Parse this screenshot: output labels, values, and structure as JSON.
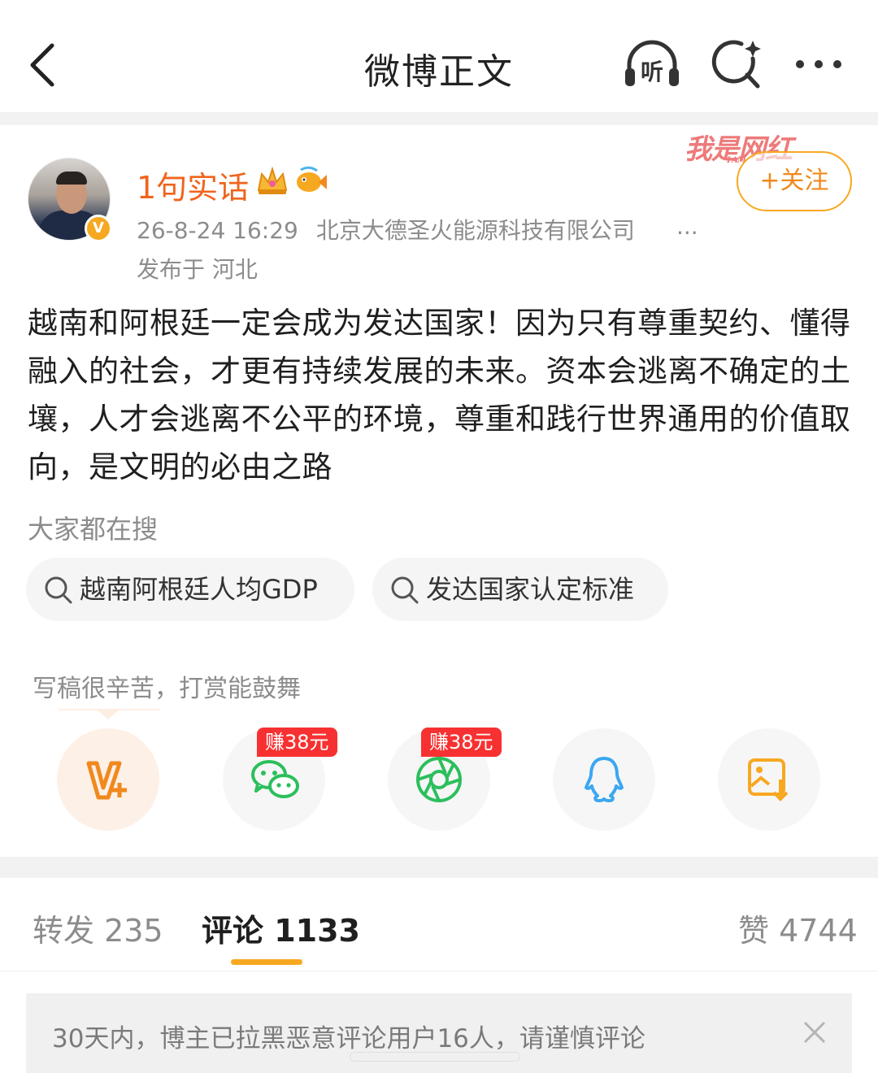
{
  "header": {
    "title": "微博正文"
  },
  "post": {
    "username": "1句实话",
    "date": "26-8-24 16:29",
    "source": "北京大德圣火能源科技有限公司",
    "meta_more": "...",
    "location": "发布于 河北",
    "verified_mark": "V",
    "follow_label": "+关注",
    "watermark_text": "我是网红",
    "watermark_sub": "I AM",
    "text": "越南和阿根廷一定会成为发达国家！因为只有尊重契约、懂得融入的社会，才更有持续发展的未来。资本会逃离不确定的土壤，人才会逃离不公平的环境，尊重和践行世界通用的价值取向，是文明的必由之路"
  },
  "hot_search": {
    "label": "大家都在搜",
    "items": [
      {
        "label": "越南阿根廷人均GDP"
      },
      {
        "label": "发达国家认定标准"
      }
    ]
  },
  "share": {
    "tip": "写稿很辛苦，打赏能鼓舞",
    "wechat_badge": "赚38元",
    "moments_badge": "赚38元",
    "icons": [
      "reward-v-plus-icon",
      "wechat-icon",
      "moments-icon",
      "qq-icon",
      "save-image-icon"
    ]
  },
  "tabs": {
    "repost": "转发 235",
    "comments": "评论 1133",
    "likes": "赞 4744"
  },
  "notice": {
    "text": "30天内，博主已拉黑恶意评论用户16人，请谨慎评论"
  },
  "colors": {
    "accent": "#f7a821",
    "username": "#f0641e",
    "badge": "#f73131"
  }
}
